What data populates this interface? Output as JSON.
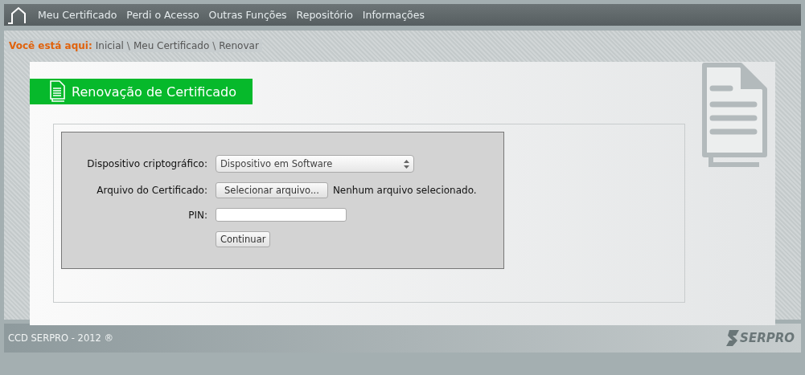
{
  "nav": {
    "items": [
      {
        "label": "Meu Certificado"
      },
      {
        "label": "Perdi o Acesso"
      },
      {
        "label": "Outras Funções"
      },
      {
        "label": "Repositório"
      },
      {
        "label": "Informações"
      }
    ]
  },
  "breadcrumb": {
    "prefix": "Você está aqui:",
    "items": [
      {
        "label": "Inicial"
      },
      {
        "label": "Meu Certificado"
      },
      {
        "label": "Renovar"
      }
    ],
    "separator": "\\"
  },
  "panel": {
    "title": "Renovação de Certificado"
  },
  "form": {
    "fields": [
      {
        "kind": "select",
        "label": "Dispositivo criptográfico:",
        "value": "Dispositivo em Software"
      },
      {
        "kind": "file",
        "label": "Arquivo do Certificado:",
        "button": "Selecionar arquivo...",
        "status": "Nenhum arquivo selecionado."
      },
      {
        "kind": "text",
        "label": "PIN:"
      }
    ],
    "submit": "Continuar"
  },
  "footer": {
    "text": "CCD SERPRO - 2012 ®",
    "logo": "SERPRO"
  }
}
